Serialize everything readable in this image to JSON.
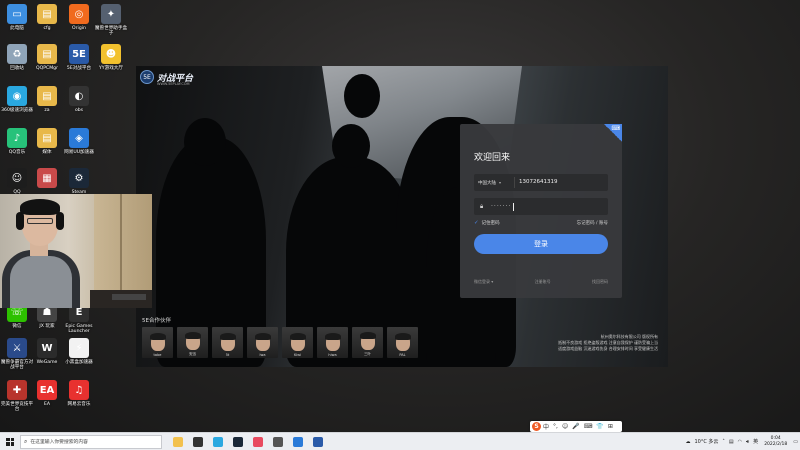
{
  "desktop_icons": [
    {
      "id": "this-pc",
      "label": "此电脑",
      "color": "#3d8fe0",
      "glyph": "▭"
    },
    {
      "id": "cfg",
      "label": "cfg",
      "color": "#e8b84a",
      "glyph": "▤"
    },
    {
      "id": "origin",
      "label": "Origin",
      "color": "#f06a1e",
      "glyph": "◎"
    },
    {
      "id": "game-box",
      "label": "魔兽世界助手盒子",
      "color": "#556070",
      "glyph": "✦"
    },
    {
      "id": "recycle-bin",
      "label": "回收站",
      "color": "#8fa4b8",
      "glyph": "♻"
    },
    {
      "id": "qqpcmgr",
      "label": "QQPCMgr",
      "color": "#e8b84a",
      "glyph": "▤"
    },
    {
      "id": "5e-platform",
      "label": "5E对战平台",
      "color": "#2a5aa8",
      "glyph": "5E"
    },
    {
      "id": "yy-game",
      "label": "YY游戏大厅",
      "color": "#f2c12e",
      "glyph": "☻"
    },
    {
      "id": "360-browser",
      "label": "360极速浏览器",
      "color": "#2aa8e0",
      "glyph": "◉"
    },
    {
      "id": "za",
      "label": "za",
      "color": "#e8b84a",
      "glyph": "▤"
    },
    {
      "id": "obs",
      "label": "obs",
      "color": "#333333",
      "glyph": "◐"
    },
    {
      "id": "qq-music",
      "label": "QQ音乐",
      "color": "#27c27a",
      "glyph": "♪"
    },
    {
      "id": "media",
      "label": "媒体",
      "color": "#e8b84a",
      "glyph": "▤"
    },
    {
      "id": "uu-accel",
      "label": "网易UU加速器",
      "color": "#2a7ad8",
      "glyph": "◈"
    },
    {
      "id": "qq",
      "label": "QQ",
      "color": "#1d1d1d",
      "glyph": "☺"
    },
    {
      "id": "doc",
      "label": "",
      "color": "#c94a4a",
      "glyph": "▦"
    },
    {
      "id": "steam",
      "label": "Steam",
      "color": "#1b2838",
      "glyph": "⚙"
    },
    {
      "id": "wechat",
      "label": "微信",
      "color": "#2dc100",
      "glyph": "☏"
    },
    {
      "id": "jx3",
      "label": "JX 玩家",
      "color": "#444444",
      "glyph": "☗"
    },
    {
      "id": "epic",
      "label": "Epic Games Launcher",
      "color": "#2f2f2f",
      "glyph": "E"
    },
    {
      "id": "wow-cn",
      "label": "魔兽争霸官方对战平台",
      "color": "#2a4a8a",
      "glyph": "⚔"
    },
    {
      "id": "wegame",
      "label": "WeGame",
      "color": "#2b2b2b",
      "glyph": "W"
    },
    {
      "id": "xiaohei-box",
      "label": "小黑盒加速器",
      "color": "#f2f2f2",
      "glyph": "⚡"
    },
    {
      "id": "wow-box",
      "label": "完美世界竞技平台",
      "color": "#b8342c",
      "glyph": "✚"
    },
    {
      "id": "ea",
      "label": "EA",
      "color": "#e8312f",
      "glyph": "EA"
    },
    {
      "id": "netease-music",
      "label": "网易云音乐",
      "color": "#e8312f",
      "glyph": "♫"
    }
  ],
  "app": {
    "logo_badge": "5E",
    "logo_name": "对战平台",
    "logo_url": "WWW.5EPLAY.COM",
    "partners_title": "5E合作伙伴",
    "partners": [
      "tabe",
      "安迅",
      "5t",
      "lwa",
      "Kiwi",
      "hiwa",
      "三叶",
      "PAL"
    ],
    "company_lines": [
      "杭州奥尔科技有限公司 版权所有",
      "抵制不良游戏 拒绝盗版游戏 注意自我保护 谨防受骗上当",
      "适度游戏益脑 沉迷游戏伤身 合理安排时间 享受健康生活"
    ]
  },
  "login": {
    "corner_icon": "⌨",
    "welcome": "欢迎回来",
    "region": "中国大陆",
    "phone": "13072641319",
    "password_mask": "·······",
    "remember_label": "记住密码",
    "forgot_label": "忘记密码 / 账号",
    "submit_label": "登录",
    "links": [
      "微信登录 ▾",
      "注册账号",
      "找回密码"
    ]
  },
  "taskbar": {
    "search_placeholder": "在这里输入你要搜索的内容",
    "apps": [
      {
        "id": "file-explorer",
        "color": "#f2c14e"
      },
      {
        "id": "obs",
        "color": "#333333"
      },
      {
        "id": "360",
        "color": "#2aa8e0"
      },
      {
        "id": "steam",
        "color": "#1b2838"
      },
      {
        "id": "app-red",
        "color": "#e84a5f"
      },
      {
        "id": "app-screen",
        "color": "#555555"
      },
      {
        "id": "app-blue",
        "color": "#2a7ad8"
      },
      {
        "id": "5e",
        "color": "#2a5aa8"
      }
    ],
    "weather": "10°C 多云",
    "time": "0:04",
    "date": "2022/2/18"
  },
  "ime": {
    "logo": "S",
    "items": [
      "中",
      "°,",
      "☺",
      "🎤",
      "⌨",
      "👕",
      "⊞"
    ]
  }
}
